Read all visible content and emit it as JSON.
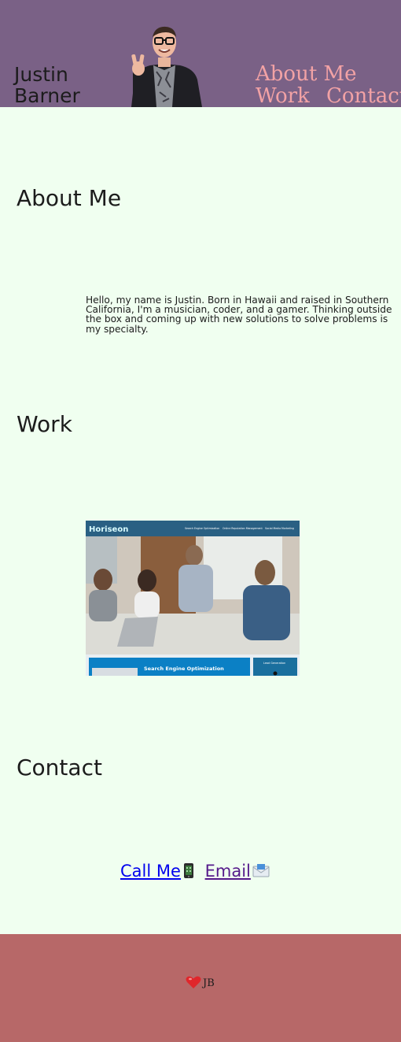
{
  "header": {
    "name": "Justin\nBarner",
    "nav": {
      "about": "About Me",
      "work": "Work",
      "contact": "Contact"
    }
  },
  "sections": {
    "about": {
      "heading": "About Me",
      "body": "Hello, my name is Justin. Born in Hawaii and raised in Southern California, I'm a musician, coder, and a gamer. Thinking outside the box and coming up with new solutions to solve problems is my specialty."
    },
    "work": {
      "heading": "Work",
      "project": {
        "brand": "Horiseon",
        "nav": [
          "Search Engine Optimization",
          "Online Reputation Management",
          "Social Media Marketing"
        ],
        "banner": "Search Engine Optimization",
        "side_label": "Lead Generation"
      }
    },
    "contact": {
      "heading": "Contact",
      "call_label": "Call Me",
      "email_label": "Email"
    }
  },
  "footer": {
    "initials": "JB"
  },
  "icons": [
    "phone-icon",
    "envelope-icon",
    "heart-icon"
  ],
  "colors": {
    "header_bg": "#7a6186",
    "page_bg": "#f0fff0",
    "nav_link": "#f2a2a5",
    "footer_bg": "#b76868"
  }
}
